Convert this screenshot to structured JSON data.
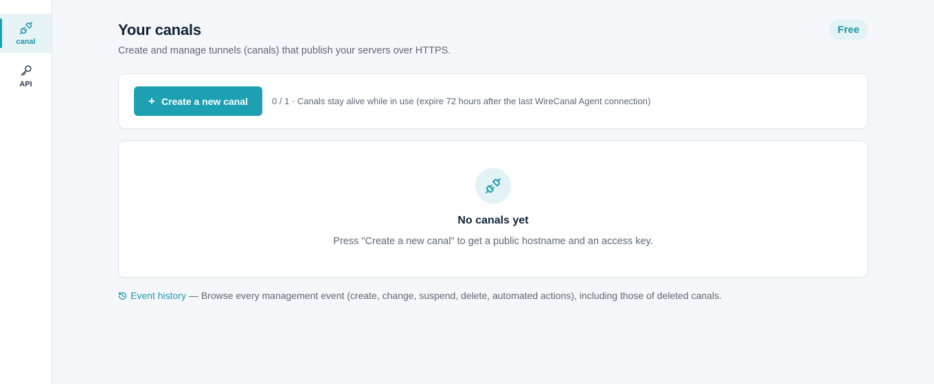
{
  "sidebar": {
    "items": [
      {
        "label": "canal",
        "icon": "plug-icon",
        "active": true
      },
      {
        "label": "API",
        "icon": "key-icon",
        "active": false
      }
    ]
  },
  "header": {
    "title": "Your canals",
    "subtitle": "Create and manage tunnels (canals) that publish your servers over HTTPS.",
    "plan_badge": "Free"
  },
  "toolbar": {
    "create_label": "Create a new canal",
    "quota_text": "0 / 1 · Canals stay alive while in use (expire 72 hours after the last WireCanal Agent connection)"
  },
  "empty_state": {
    "icon": "plug-icon",
    "title": "No canals yet",
    "description": "Press \"Create a new canal\" to get a public hostname and an access key."
  },
  "history": {
    "link_label": "Event history",
    "description": "— Browse every management event (create, change, suspend, delete, automated actions), including those of deleted canals."
  },
  "colors": {
    "accent": "#1da0b2",
    "accent_soft": "#e3f3f5",
    "background": "#f6f7fa",
    "text_primary": "#0f2438",
    "text_secondary": "#5b6776"
  }
}
